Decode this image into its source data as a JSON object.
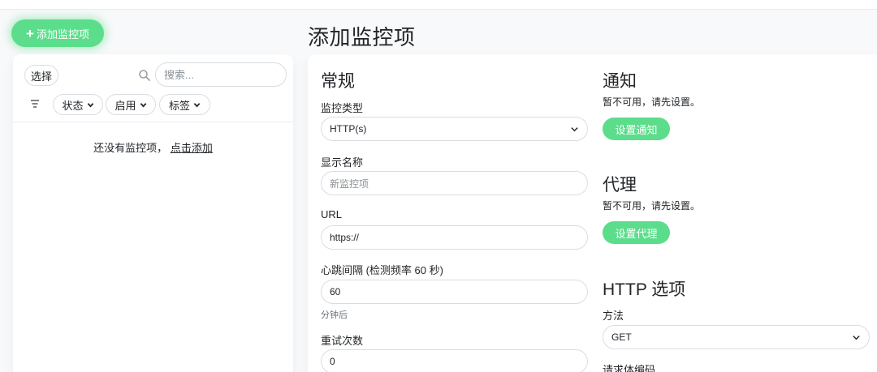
{
  "header": {
    "add_button_label": "添加监控项",
    "page_title": "添加监控项"
  },
  "list": {
    "select_label": "选择",
    "search_placeholder": "搜索...",
    "filters": [
      {
        "label": "状态"
      },
      {
        "label": "启用"
      },
      {
        "label": "标签"
      }
    ],
    "empty_text": "还没有监控项，",
    "empty_link": "点击添加"
  },
  "general": {
    "heading": "常规",
    "monitor_type_label": "监控类型",
    "monitor_type_value": "HTTP(s)",
    "display_name_label": "显示名称",
    "display_name_placeholder": "新监控项",
    "url_label": "URL",
    "url_value": "https://",
    "interval_label": "心跳间隔 (检测频率 60 秒)",
    "interval_value": "60",
    "interval_hint": "分钟后",
    "retries_label": "重试次数",
    "retries_value": "0"
  },
  "notifications": {
    "heading": "通知",
    "unavailable_text": "暂不可用，请先设置。",
    "button_label": "设置通知"
  },
  "proxy": {
    "heading": "代理",
    "unavailable_text": "暂不可用，请先设置。",
    "button_label": "设置代理"
  },
  "http_options": {
    "heading": "HTTP 选项",
    "method_label": "方法",
    "method_value": "GET",
    "body_encoding_label": "请求体编码"
  },
  "colors": {
    "accent": "#5cdd8b",
    "background": "#f8f9fa",
    "panel": "#ffffff",
    "border": "#d9dde2"
  },
  "icons": [
    "plus-icon",
    "search-icon",
    "filter-menu-icon",
    "chevron-down-icon"
  ]
}
